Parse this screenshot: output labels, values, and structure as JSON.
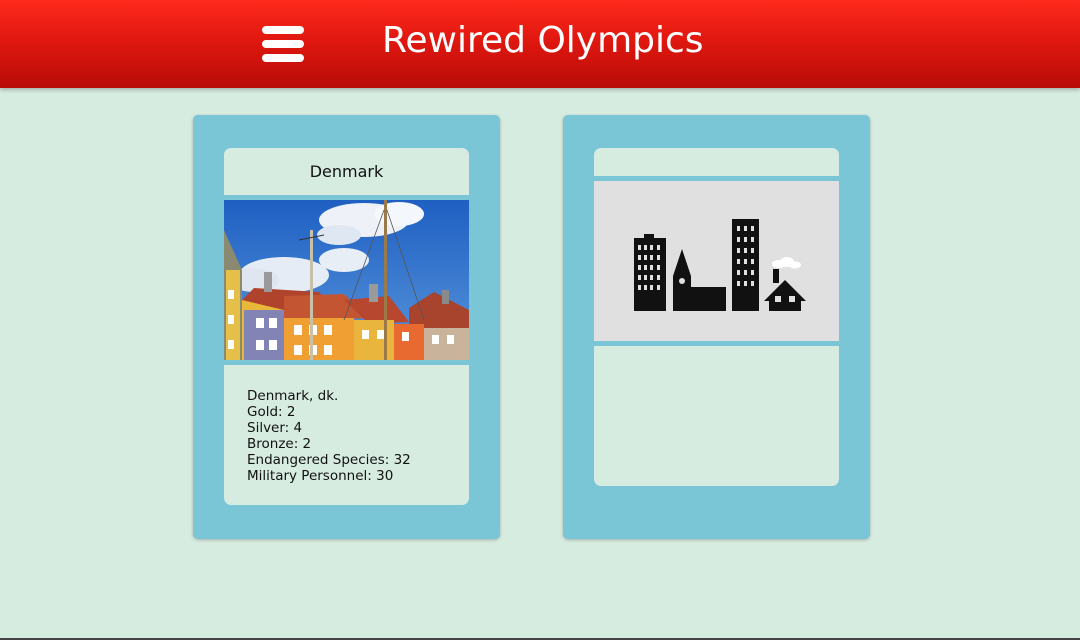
{
  "header": {
    "title": "Rewired Olympics",
    "menu_icon": "hamburger-menu-icon",
    "background": "#e01810"
  },
  "cards": {
    "active": {
      "country": "Denmark",
      "image": "nyhavn-colorful-harbour-houses-photo",
      "stats": [
        "Denmark, dk.",
        "Gold: 2",
        "Silver: 4",
        "Bronze: 2",
        "Endangered Species: 32",
        "Military Personnel: 30"
      ]
    },
    "hidden": {
      "image_icon": "city-skyline-icon"
    }
  },
  "colors": {
    "page_background": "#d7ece1",
    "card_background": "#7ac5d6",
    "panel_background": "#d7ece1"
  }
}
